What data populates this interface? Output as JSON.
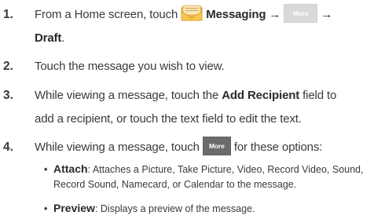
{
  "steps": [
    {
      "number": "1.",
      "pre": "From a Home screen, touch",
      "messaging_label": "Messaging",
      "arrow1": "→",
      "more_label": "More",
      "arrow2": "→",
      "draft_label": "Draft",
      "end": "."
    },
    {
      "number": "2.",
      "text": "Touch the message you wish to view."
    },
    {
      "number": "3.",
      "line1_pre": "While viewing a message, touch the",
      "add_recipient": "Add Recipient",
      "line1_post": "field to",
      "line2": "add a recipient, or touch the text field to edit the text."
    },
    {
      "number": "4.",
      "pre": "While viewing a message, touch",
      "more_label": "More",
      "post": "for these options:"
    }
  ],
  "options": [
    {
      "bullet": "•",
      "name": "Attach",
      "line1": ": Attaches a Picture, Take Picture, Video, Record Video, Sound,",
      "line2": "Record Sound, Namecard, or Calendar to the message."
    },
    {
      "bullet": "•",
      "name": "Preview",
      "line1": ": Displays a preview of the message."
    }
  ],
  "icons": {
    "messaging": "envelope-icon"
  },
  "colors": {
    "text": "#3a3a3a",
    "more_light": "#d9d9d9",
    "more_dark": "#6b6b6b",
    "icon_envelope": "#f2c04a"
  }
}
